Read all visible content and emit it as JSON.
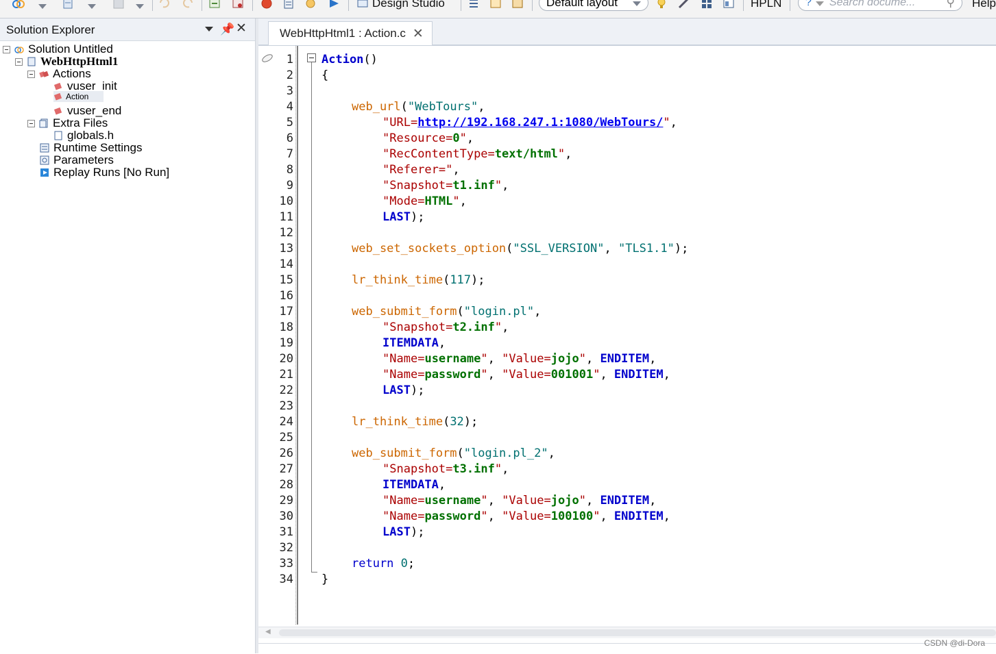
{
  "toolbar": {
    "design_studio_label": "Design Studio",
    "layout_combo": "Default layout",
    "hpln_label": "HPLN",
    "search_placeholder": "Search docume...",
    "help_label": "Help"
  },
  "solution_explorer": {
    "title": "Solution Explorer",
    "tree": {
      "solution": "Solution Untitled",
      "script": "WebHttpHtml1",
      "actions_folder": "Actions",
      "action_vuser_init": "vuser_init",
      "action_action": "Action",
      "action_vuser_end": "vuser_end",
      "extra_files": "Extra Files",
      "globals": "globals.h",
      "runtime_settings": "Runtime Settings",
      "parameters": "Parameters",
      "replay_runs": "Replay Runs [No Run]"
    }
  },
  "editor": {
    "tab_title": "WebHttpHtml1 : Action.c",
    "line_numbers": [
      "1",
      "2",
      "3",
      "4",
      "5",
      "6",
      "7",
      "8",
      "9",
      "10",
      "11",
      "12",
      "13",
      "14",
      "15",
      "16",
      "17",
      "18",
      "19",
      "20",
      "21",
      "22",
      "23",
      "24",
      "25",
      "26",
      "27",
      "28",
      "29",
      "30",
      "31",
      "32",
      "33",
      "34"
    ],
    "code": {
      "l1_fn": "Action",
      "l1_paren": "()",
      "l2": "{",
      "l4_fn": "web_url",
      "l4_arg": "\"WebTours\"",
      "l5_url": "http://192.168.247.1:1080/WebTours/",
      "l6_key": "Resource",
      "l6_val": "0",
      "l7_key": "RecContentType",
      "l7_val": "text/html",
      "l8_key": "Referer",
      "l9_key": "Snapshot",
      "l9_val": "t1.inf",
      "l10_key": "Mode",
      "l10_val": "HTML",
      "last": "LAST",
      "l13_fn": "web_set_sockets_option",
      "l13_arg1": "\"SSL_VERSION\"",
      "l13_arg2": "\"TLS1.1\"",
      "l15_fn": "lr_think_time",
      "l15_num": "117",
      "l17_fn": "web_submit_form",
      "l17_arg": "\"login.pl\"",
      "l18_val": "t2.inf",
      "itemdata": "ITEMDATA",
      "name_key": "Name",
      "value_key": "Value",
      "username": "username",
      "password": "password",
      "jojo": "jojo",
      "pw1": "001001",
      "enditem": "ENDITEM",
      "l24_num": "32",
      "l26_arg": "\"login.pl_2\"",
      "l27_val": "t3.inf",
      "pw2": "100100",
      "l33_kw": "return",
      "l33_num": "0",
      "l34": "}"
    }
  },
  "watermark": "CSDN @di-Dora",
  "colors": {
    "function": "#cc6600",
    "keyword": "#0000cc",
    "string": "#007070",
    "value": "#007000",
    "link": "#0000ee"
  }
}
